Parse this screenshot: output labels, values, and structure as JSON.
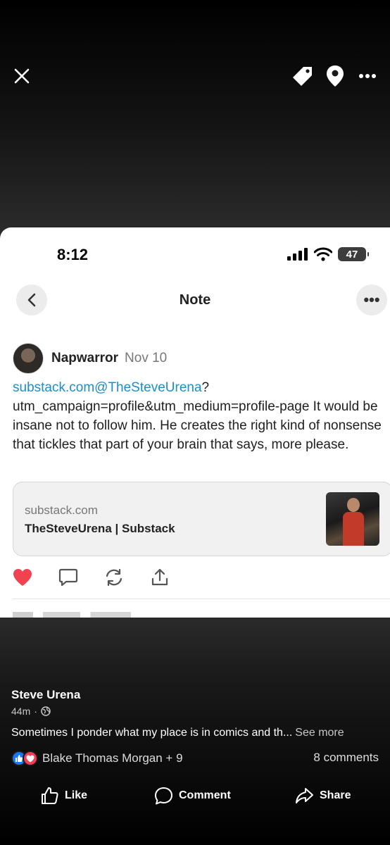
{
  "viewer": {
    "close_icon": "close-icon",
    "tag_icon": "tag-icon",
    "location_icon": "location-pin-icon",
    "more_icon": "more-horizontal-icon"
  },
  "screenshot": {
    "status_bar": {
      "time": "8:12",
      "battery": "47"
    },
    "nav": {
      "title": "Note",
      "more": "•••"
    },
    "note": {
      "author": "Napwarror",
      "date": "Nov 10",
      "link_text": "substack.com@TheSteveUrena",
      "body_text": "?utm_campaign=profile&utm_medium=profile-page It would be insane not to follow him. He creates the right kind of nonsense that tickles that part of your brain that says, more please."
    },
    "link_card": {
      "domain": "substack.com",
      "title": "TheSteveUrena | Substack"
    },
    "like_color": "#f0424f"
  },
  "post": {
    "author": "Steve Urena",
    "time": "44m",
    "separator": "·",
    "text": "Sometimes I ponder what my place is in comics and th...",
    "see_more": "See more",
    "reacted_by": "Blake Thomas Morgan + 9",
    "comments": "8 comments"
  },
  "actions": {
    "like": "Like",
    "comment": "Comment",
    "share": "Share"
  },
  "colors": {
    "fb_blue": "#1877f2",
    "love_red": "#f33e58",
    "link_blue": "#1a8fc9"
  }
}
